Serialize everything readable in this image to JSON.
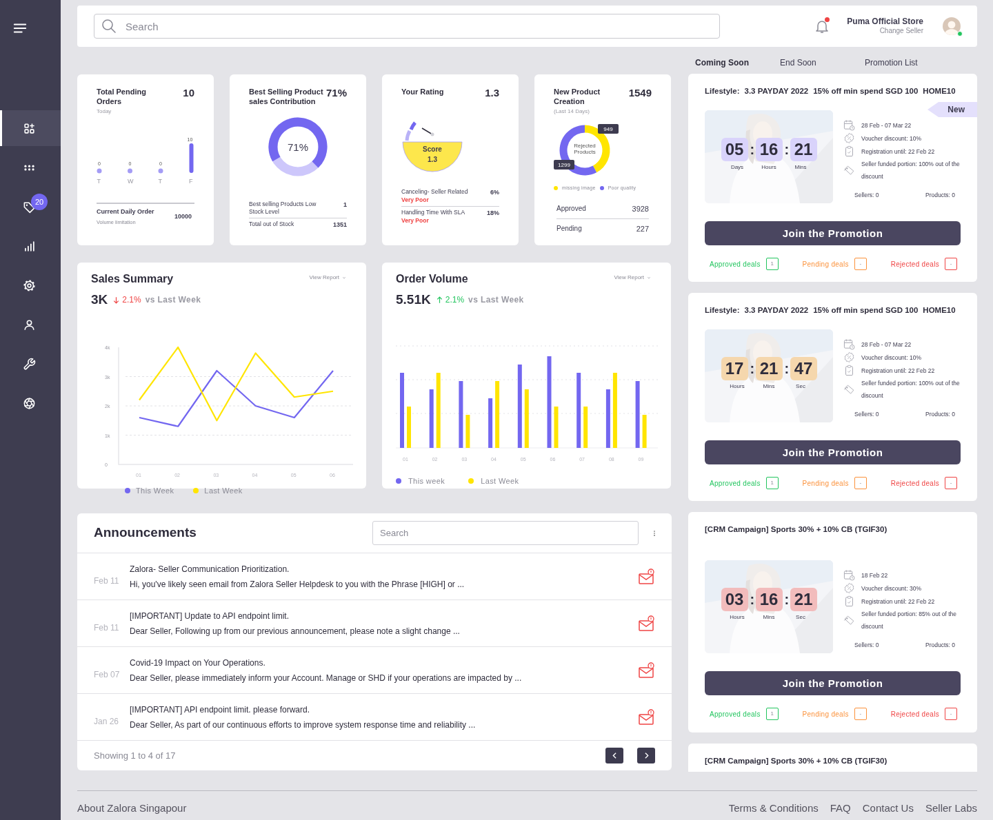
{
  "sidebar": {
    "items": [
      {
        "kind": "dashboard",
        "selected": true
      },
      {
        "kind": "apps",
        "selected": false
      },
      {
        "kind": "tag",
        "selected": false,
        "badge": "20"
      },
      {
        "kind": "chart",
        "selected": false
      },
      {
        "kind": "settings",
        "selected": false
      },
      {
        "kind": "user",
        "selected": false
      },
      {
        "kind": "tools",
        "selected": false
      },
      {
        "kind": "aperture",
        "selected": false
      }
    ]
  },
  "header": {
    "search": {
      "placeholder": "Search"
    },
    "notifications": {
      "unread": true
    },
    "seller": {
      "name": "Puma Official Store",
      "action": "Change Seller",
      "online": true
    }
  },
  "stat_cards": [
    {
      "kind": "pending",
      "title": "Total Pending Orders",
      "value": "10",
      "subtitle": "Today",
      "chart_data": {
        "type": "bar",
        "categories": [
          "T",
          "W",
          "T",
          "F"
        ],
        "values": [
          0,
          0,
          0,
          10
        ],
        "data_labels": true
      },
      "footer": {
        "label": "Current Daily Order",
        "sublabel": "Volume limitation",
        "value": "10000"
      }
    },
    {
      "kind": "contribution",
      "title": "Best Selling Product sales Contribution",
      "value": "71%",
      "ring": {
        "level": 0.71,
        "label": "71%"
      },
      "rows": [
        {
          "label": "Best selling Products Low Stock Level",
          "value": "1"
        },
        {
          "label": "Total out of Stock",
          "value": "1351"
        }
      ]
    },
    {
      "kind": "rating",
      "title": "Your Rating",
      "value": "1.3",
      "gauge": {
        "label": "Score",
        "value": "1.3"
      },
      "rows": [
        {
          "label": "Canceling- Seller Related",
          "value": "6%",
          "rating": "Very Poor"
        },
        {
          "label": "Handling Time With SLA",
          "value": "18%",
          "rating": "Very Poor"
        }
      ]
    },
    {
      "kind": "creation",
      "title": "New Product Creation",
      "subtitle": "(Last 14 Days)",
      "value": "1549",
      "segments": [
        {
          "color": "#ffe500"
        },
        {
          "color": "#7367f0"
        }
      ],
      "chart_data": {
        "type": "donut",
        "title": "Rejected Products",
        "categories": [
          "missing image",
          "Poor quality"
        ],
        "values": [
          949,
          1299
        ],
        "data_labels": true,
        "value_labels": [
          "949",
          "1299"
        ]
      },
      "rows": [
        {
          "label": "Approved",
          "value": "3928"
        },
        {
          "label": "Pending",
          "value": "227"
        }
      ]
    }
  ],
  "sales_summary": {
    "title": "Sales Summary",
    "value": "3K",
    "rising": false,
    "change": "2.1%",
    "comparison": "vs Last Week",
    "action": "View Report",
    "chart_data": {
      "type": "line",
      "categories": [
        "01",
        "02",
        "03",
        "04",
        "05",
        "06"
      ],
      "series": [
        {
          "name": "This Week",
          "color": "#7367f0",
          "values": [
            1600,
            1300,
            3200,
            2000,
            1600,
            3200
          ]
        },
        {
          "name": "Last Week",
          "color": "#ffe500",
          "values": [
            2200,
            4000,
            1500,
            3800,
            2300,
            2500
          ]
        }
      ],
      "ylim": [
        0,
        4000
      ],
      "grid": true,
      "yticks": [
        0,
        {
          "value": 1000,
          "label": "1k"
        },
        {
          "value": 2000,
          "label": "2k"
        },
        {
          "value": 3000,
          "label": "3k"
        },
        {
          "value": 4000,
          "label": "4k"
        }
      ]
    }
  },
  "order_volume": {
    "title": "Order Volume",
    "value": "5.51K",
    "rising": true,
    "change": "2.1%",
    "comparison": "vs Last Week",
    "action": "View Report",
    "x_labels": [
      "01",
      "02",
      "03",
      "04",
      "05",
      "06",
      "07",
      "08",
      "09"
    ],
    "legend": [
      {
        "label": "This week",
        "color": "#7367f0"
      },
      {
        "label": "Last Week",
        "color": "#ffe500"
      }
    ]
  },
  "announcements": {
    "title": "Announcements",
    "search": {
      "placeholder": "Search"
    },
    "items": [
      {
        "date": "Feb 11",
        "title": "Zalora- Seller Communication Prioritization.",
        "text": "Hi, you've likely seen email from Zalora Seller Helpdesk to you with the Phrase [HIGH] or ..."
      },
      {
        "date": "Feb 11",
        "title": "[IMPORTANT] Update to API endpoint limit.",
        "text": "Dear Seller, Following up from our previous announcement, please note a slight change ..."
      },
      {
        "date": "Feb 07",
        "title": "Covid-19 Impact on Your Operations.",
        "text": "Dear Seller, please immediately inform your Account. Manage or SHD if your operations are impacted by ..."
      },
      {
        "date": "Jan 26",
        "title": "[IMPORTANT] API endpoint limit. please forward.",
        "text": "Dear Seller, As part of our continuous efforts to improve system response time and reliability ..."
      }
    ],
    "summary": "Showing 1 to 4 of 17"
  },
  "promotions": {
    "tabs": [
      {
        "label": "Coming Soon",
        "selected": true
      },
      {
        "label": "End Soon",
        "selected": false
      },
      {
        "label": "Promotion List",
        "selected": false
      }
    ],
    "items": [
      {
        "title": [
          "Lifestyle:",
          "3.3 PAYDAY 2022",
          "15% off min spend SGD 100",
          "HOME10"
        ],
        "badge": "New",
        "color": "#d9d3fb",
        "separator": ":",
        "timer": [
          {
            "value": "05",
            "unit": "Days"
          },
          {
            "value": "16",
            "unit": "Hours"
          },
          {
            "value": "21",
            "unit": "Mins"
          }
        ],
        "details": [
          {
            "kind": "date",
            "text": "28 Feb - 07 Mar 22"
          },
          {
            "kind": "voucher",
            "text": "Voucher discount: 10%"
          },
          {
            "kind": "registration",
            "text": "Registration until: 22 Feb 22"
          },
          {
            "kind": "funding",
            "text": "Seller funded portion: 100% out of the discount"
          }
        ],
        "sellers": "Sellers:  0",
        "products": "Products:  0",
        "button": "Join the Promotion",
        "deals": [
          {
            "label": "Approved deals",
            "count": "1",
            "color": "#22c55e"
          },
          {
            "label": "Pending deals",
            "count": "-",
            "color": "#fb923c"
          },
          {
            "label": "Rejected deals",
            "count": "-",
            "color": "#ef4444"
          }
        ]
      },
      {
        "title": [
          "Lifestyle:",
          "3.3 PAYDAY 2022",
          "15% off min spend SGD 100",
          "HOME10"
        ],
        "color": "#f5d7ad",
        "separator": ":",
        "timer": [
          {
            "value": "17",
            "unit": "Hours"
          },
          {
            "value": "21",
            "unit": "Mins"
          },
          {
            "value": "47",
            "unit": "Sec"
          }
        ],
        "details": [
          {
            "kind": "date",
            "text": "28 Feb - 07 Mar 22"
          },
          {
            "kind": "voucher",
            "text": "Voucher discount: 10%"
          },
          {
            "kind": "registration",
            "text": "Registration until: 22 Feb 22"
          },
          {
            "kind": "funding",
            "text": "Seller funded portion: 100% out of the discount"
          }
        ],
        "sellers": "Sellers:  0",
        "products": "Products:  0",
        "button": "Join the Promotion",
        "deals": [
          {
            "label": "Approved deals",
            "count": "1",
            "color": "#22c55e"
          },
          {
            "label": "Pending deals",
            "count": "-",
            "color": "#fb923c"
          },
          {
            "label": "Rejected deals",
            "count": "-",
            "color": "#ef4444"
          }
        ]
      },
      {
        "title": [
          "[CRM Campaign] Sports 30% + 10% CB (TGIF30)"
        ],
        "color": "#f2bcbc",
        "separator": ":",
        "timer": [
          {
            "value": "03",
            "unit": "Hours"
          },
          {
            "value": "16",
            "unit": "Mins"
          },
          {
            "value": "21",
            "unit": "Sec"
          }
        ],
        "details": [
          {
            "kind": "date",
            "text": "18 Feb  22"
          },
          {
            "kind": "voucher",
            "text": "Voucher discount: 30%"
          },
          {
            "kind": "registration",
            "text": "Registration until: 22 Feb 22"
          },
          {
            "kind": "funding",
            "text": "Seller funded portion: 85% out of the discount"
          }
        ],
        "sellers": "Sellers:  0",
        "products": "Products:  0",
        "button": "Join the Promotion",
        "deals": [
          {
            "label": "Approved deals",
            "count": "1",
            "color": "#22c55e"
          },
          {
            "label": "Pending deals",
            "count": "-",
            "color": "#fb923c"
          },
          {
            "label": "Rejected deals",
            "count": "-",
            "color": "#ef4444"
          }
        ]
      },
      {
        "title": [
          "[CRM Campaign] Sports 30% + 10% CB (TGIF30)"
        ]
      }
    ]
  },
  "footer": {
    "about": "About Zalora Singapour",
    "links": [
      "Terms & Conditions",
      "FAQ",
      "Contact Us",
      "Seller Labs"
    ]
  }
}
